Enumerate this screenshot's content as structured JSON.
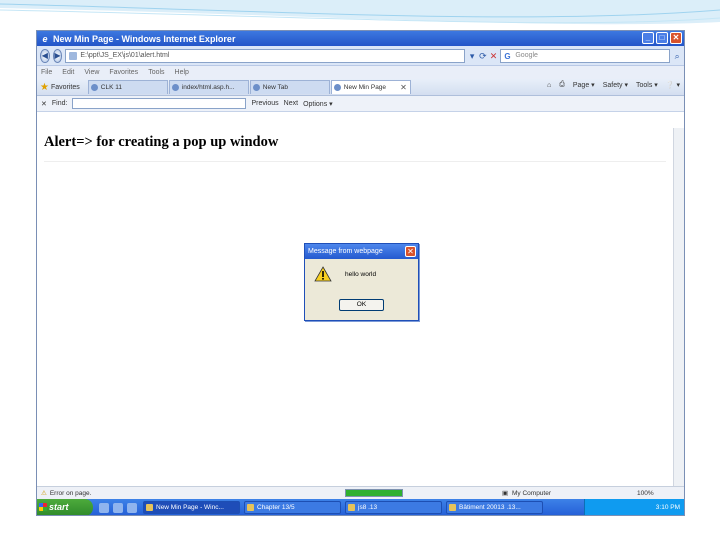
{
  "window": {
    "title": "New Min Page - Windows Internet Explorer",
    "address": "E:\\ppt\\JS_EX\\js\\01\\alert.html",
    "search_placeholder": "Google",
    "min": "_",
    "max": "□",
    "close": "✕"
  },
  "menu": [
    "File",
    "Edit",
    "View",
    "Favorites",
    "Tools",
    "Help"
  ],
  "favorites_label": "Favorites",
  "tabs": [
    {
      "label": "CLK 11"
    },
    {
      "label": "index/html.asp.h..."
    },
    {
      "label": "New Tab"
    },
    {
      "label": "New Min Page",
      "close": "✕"
    }
  ],
  "command_bar": [
    "Page ▾",
    "Safety ▾",
    "Tools ▾",
    "❔ ▾"
  ],
  "find_bar": {
    "label": "Find:",
    "previous": "Previous",
    "next": "Next",
    "options": "Options ▾",
    "close": "✕"
  },
  "page": {
    "heading": "Alert=> for creating a pop up window"
  },
  "dialog": {
    "title": "Message from webpage",
    "message": "hello world",
    "ok": "OK",
    "close": "✕"
  },
  "status": {
    "left": "Error on page.",
    "zone": "My Computer",
    "zoom": "100%",
    "progress": 1.0
  },
  "taskbar": {
    "start": "start",
    "tasks": [
      "New Min Page - Winc...",
      "Chapter 13/5",
      "js8 .13",
      "Bâtiment 20013 .13..."
    ],
    "clock": "3:10 PM"
  },
  "colors": {
    "titlebar": "#2355c8",
    "dialog_bg": "#ece9d8",
    "taskbar": "#245ed6"
  }
}
